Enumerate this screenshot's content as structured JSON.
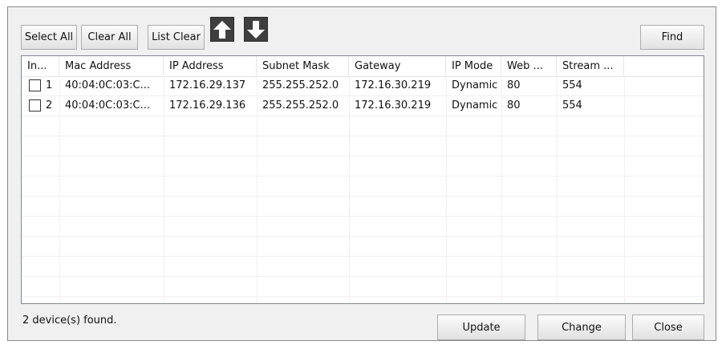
{
  "toolbar": {
    "select_all_label": "Select All",
    "clear_all_label": "Clear All",
    "list_clear_label": "List Clear",
    "move_up_icon": "arrow-up-icon",
    "move_down_icon": "arrow-down-icon",
    "find_label": "Find"
  },
  "table": {
    "columns": [
      "In...",
      "Mac Address",
      "IP Address",
      "Subnet Mask",
      "Gateway",
      "IP Mode",
      "Web ...",
      "Stream ..."
    ],
    "rows": [
      {
        "index": "1",
        "checked": false,
        "mac": "40:04:0C:03:C...",
        "ip": "172.16.29.137",
        "subnet": "255.255.252.0",
        "gateway": "172.16.30.219",
        "ip_mode": "Dynamic",
        "web": "80",
        "stream": "554"
      },
      {
        "index": "2",
        "checked": false,
        "mac": "40:04:0C:03:C...",
        "ip": "172.16.29.136",
        "subnet": "255.255.252.0",
        "gateway": "172.16.30.219",
        "ip_mode": "Dynamic",
        "web": "80",
        "stream": "554"
      }
    ]
  },
  "status": {
    "found_text": "2 device(s) found."
  },
  "footer": {
    "update_label": "Update",
    "change_label": "Change",
    "close_label": "Close"
  },
  "colors": {
    "window_bg": "#f0f0f0",
    "grid_bg": "#ffffff",
    "arrow_button_bg": "#3f3f3f"
  }
}
